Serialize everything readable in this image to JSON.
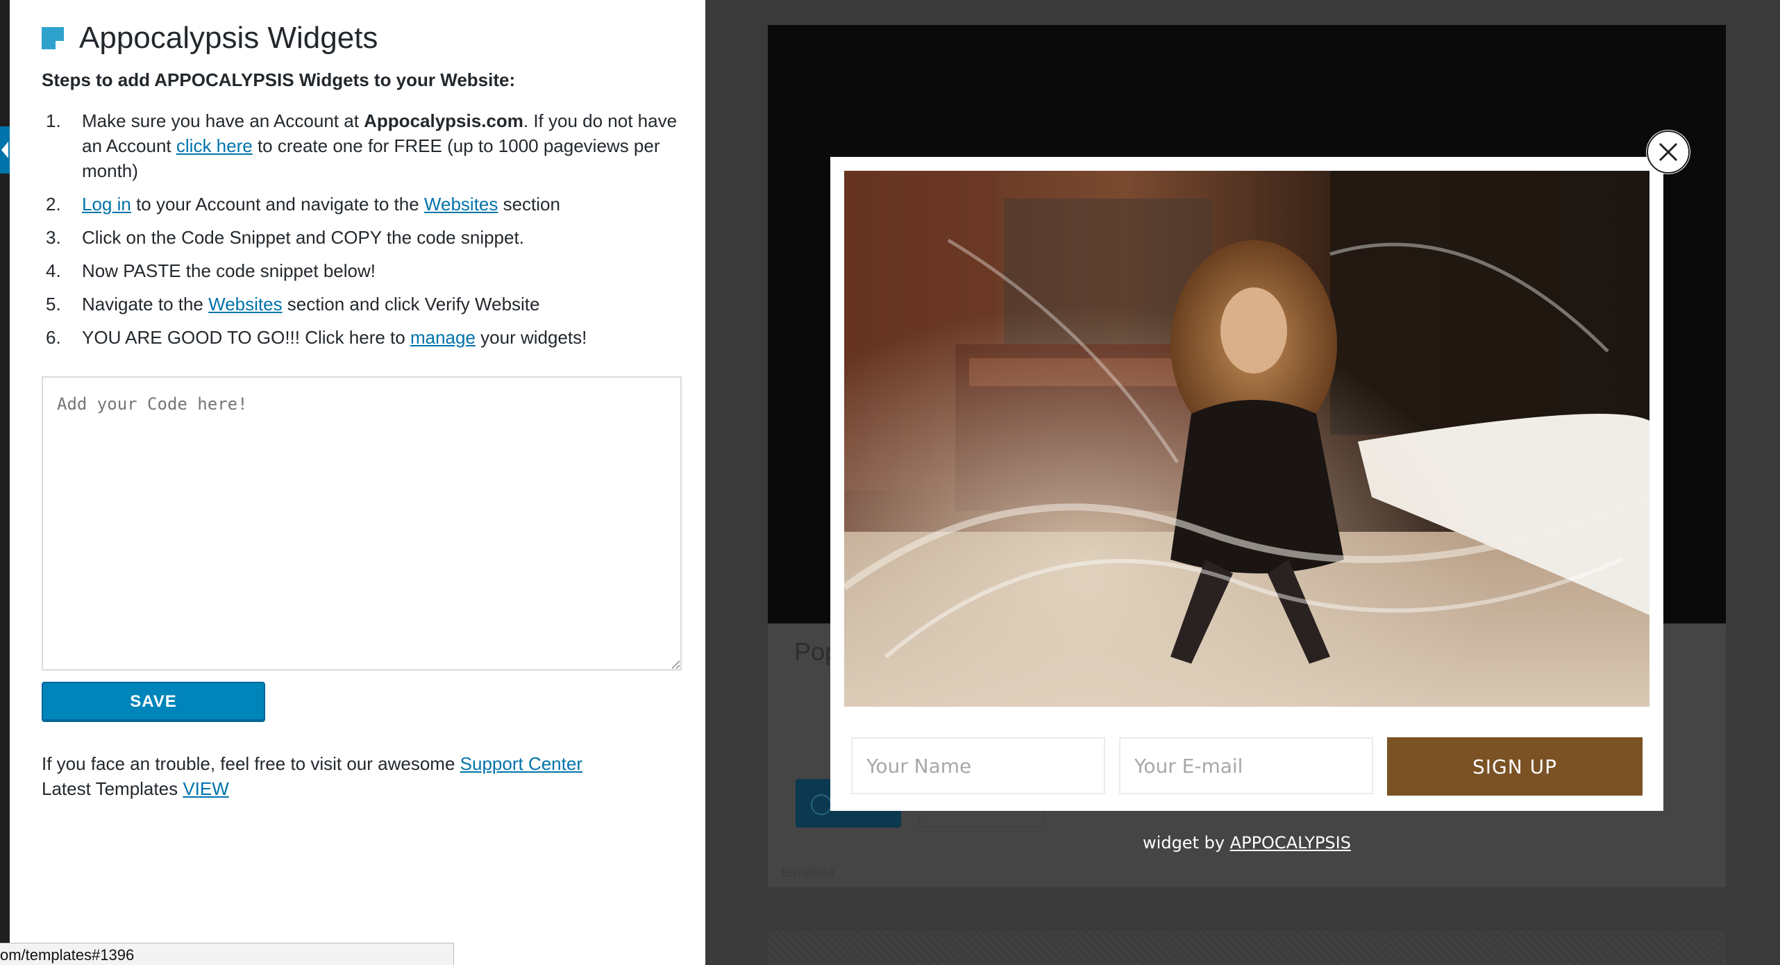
{
  "panel": {
    "title": "Appocalypsis Widgets",
    "steps_heading": "Steps to add APPOCALYPSIS Widgets to your Website:",
    "steps": [
      {
        "num": "1.",
        "parts": [
          "Make sure you have an Account at ",
          "Appocalypsis.com",
          ". If you do not have an Account ",
          "click here",
          " to create one for FREE (up to 1000 pageviews per month)"
        ]
      },
      {
        "num": "2.",
        "parts": [
          "Log in",
          " to your Account and navigate to the ",
          "Websites",
          " section"
        ]
      },
      {
        "num": "3.",
        "text": "Click on the Code Snippet and COPY the code snippet."
      },
      {
        "num": "4.",
        "text": "Now PASTE the code snippet below!"
      },
      {
        "num": "5.",
        "parts": [
          "Navigate to the ",
          "Websites",
          " section and click Verify Website"
        ]
      },
      {
        "num": "6.",
        "parts": [
          "YOU ARE GOOD TO GO!!! Click here to ",
          "manage",
          " your widgets!"
        ]
      }
    ],
    "code_placeholder": "Add your Code here!",
    "save_label": "SAVE",
    "support_text": "If you face an trouble, feel free to visit our awesome ",
    "support_link": "Support Center",
    "templates_text": "Latest Templates ",
    "templates_link": "VIEW"
  },
  "status_bar": {
    "url": "om/templates#1396"
  },
  "background_card": {
    "title": "Pop",
    "caption": "template"
  },
  "popup": {
    "name_placeholder": "Your Name",
    "email_placeholder": "Your E-mail",
    "signup_label": "SIGN UP",
    "credit_prefix": "widget by ",
    "credit_brand": "APPOCALYPSIS"
  },
  "colors": {
    "accent_blue": "#0085ba",
    "link_blue": "#0073aa",
    "signup_brown": "#7a5224",
    "overlay": "#3a3a3a"
  },
  "icons": {
    "title_icon": "widget-square-icon",
    "close_icon": "close-x-icon",
    "collapse_icon": "chevron-left-icon"
  }
}
